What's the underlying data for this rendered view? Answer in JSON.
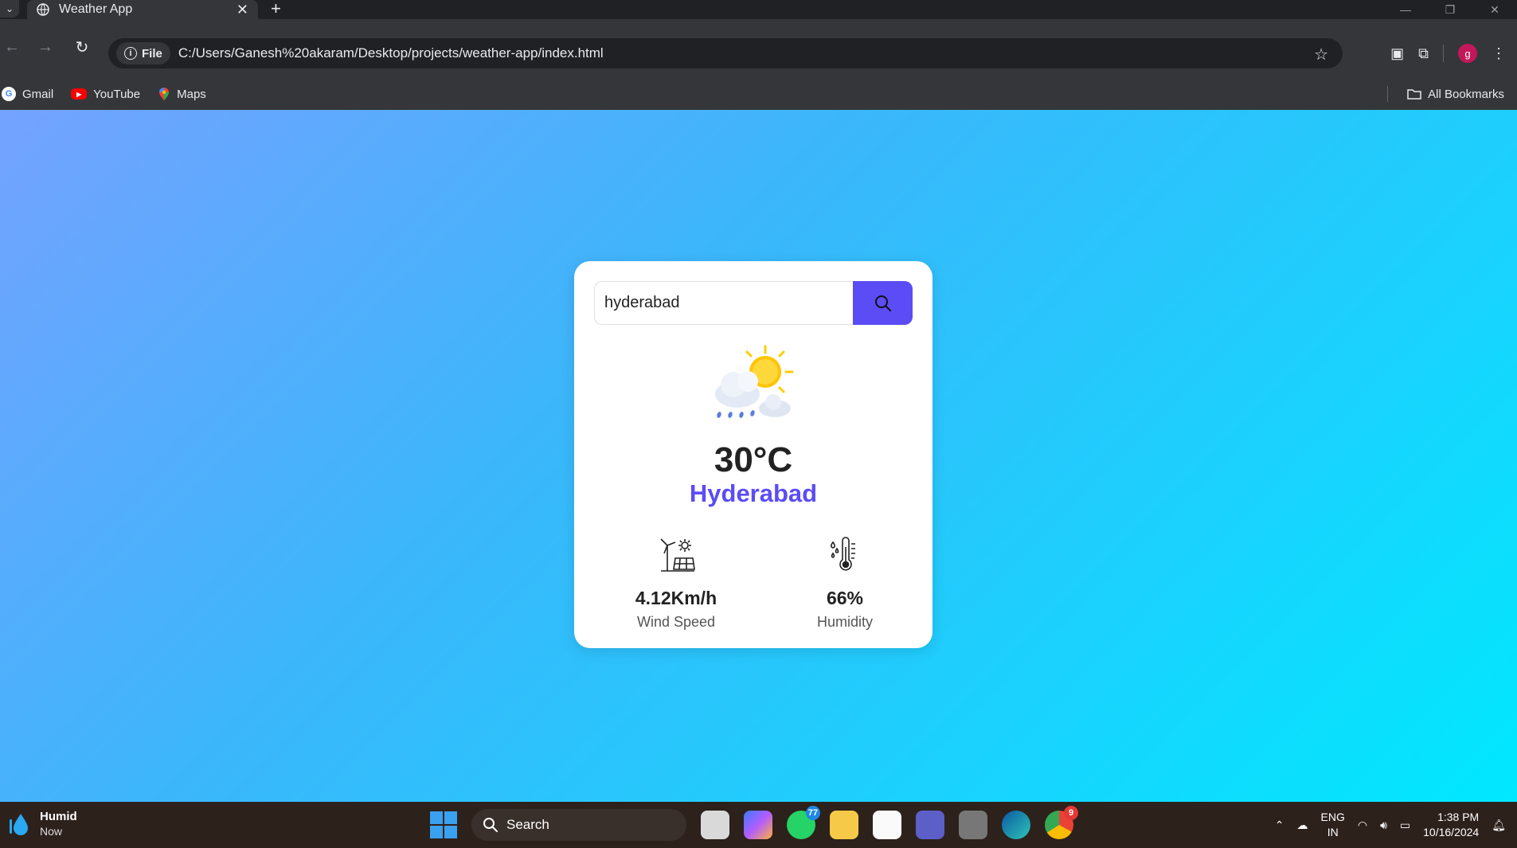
{
  "browser": {
    "tab_title": "Weather App",
    "new_tab_symbol": "+",
    "address_chip": "File",
    "url": "C:/Users/Ganesh%20akaram/Desktop/projects/weather-app/index.html",
    "profile_initial": "g",
    "bookmarks": [
      {
        "label": "Gmail",
        "icon": "google-icon",
        "color": "#ea4335"
      },
      {
        "label": "YouTube",
        "icon": "youtube-icon",
        "color": "#ff0000"
      },
      {
        "label": "Maps",
        "icon": "maps-icon",
        "color": "#34a853"
      }
    ],
    "all_bookmarks": "All Bookmarks"
  },
  "app": {
    "search_value": "hyderabad",
    "weather_condition_icon": "sun-cloud-rain-icon",
    "temperature": "30°C",
    "city": "Hyderabad",
    "wind_speed": "4.12Km/h",
    "wind_label": "Wind Speed",
    "humidity": "66%",
    "humidity_label": "Humidity",
    "accent_color": "#5b4cf5"
  },
  "taskbar": {
    "weather_title": "Humid",
    "weather_sub": "Now",
    "search_label": "Search",
    "whatsapp_badge": "77",
    "chrome_badge": "9",
    "lang_top": "ENG",
    "lang_bottom": "IN",
    "time": "1:38 PM",
    "date": "10/16/2024"
  }
}
